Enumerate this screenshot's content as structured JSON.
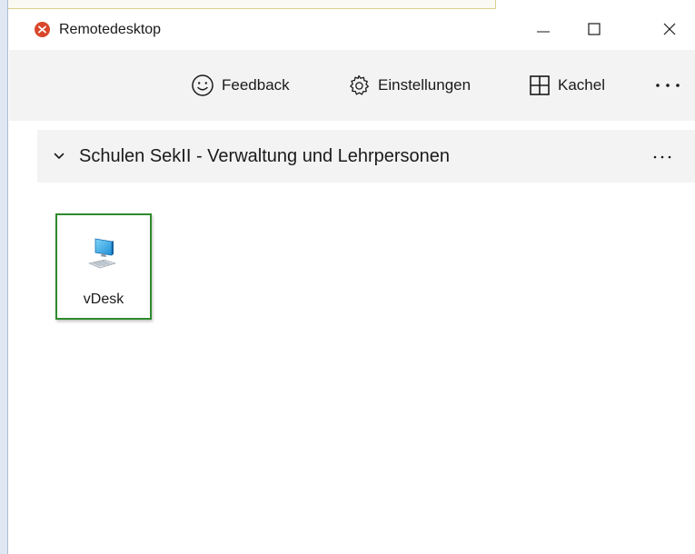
{
  "window": {
    "title": "Remotedesktop",
    "app_icon": "remote-desktop-icon",
    "controls": {
      "minimize": "minimize-icon",
      "maximize": "maximize-icon",
      "close": "close-icon"
    }
  },
  "toolbar": {
    "feedback_label": "Feedback",
    "feedback_icon": "smiley-icon",
    "settings_label": "Einstellungen",
    "settings_icon": "gear-icon",
    "tile_label": "Kachel",
    "tile_icon": "grid-icon",
    "more_icon": "more-icon"
  },
  "group": {
    "title": "Schulen SekII - Verwaltung und Lehrpersonen",
    "chevron_icon": "chevron-down-icon",
    "more_icon": "more-icon"
  },
  "workspaces": [
    {
      "label": "vDesk",
      "icon": "desktop-pc-icon"
    }
  ],
  "colors": {
    "accent_border": "#2e8b2e",
    "app_icon": "#d9472b",
    "toolbar_bg": "#f3f3f3"
  }
}
